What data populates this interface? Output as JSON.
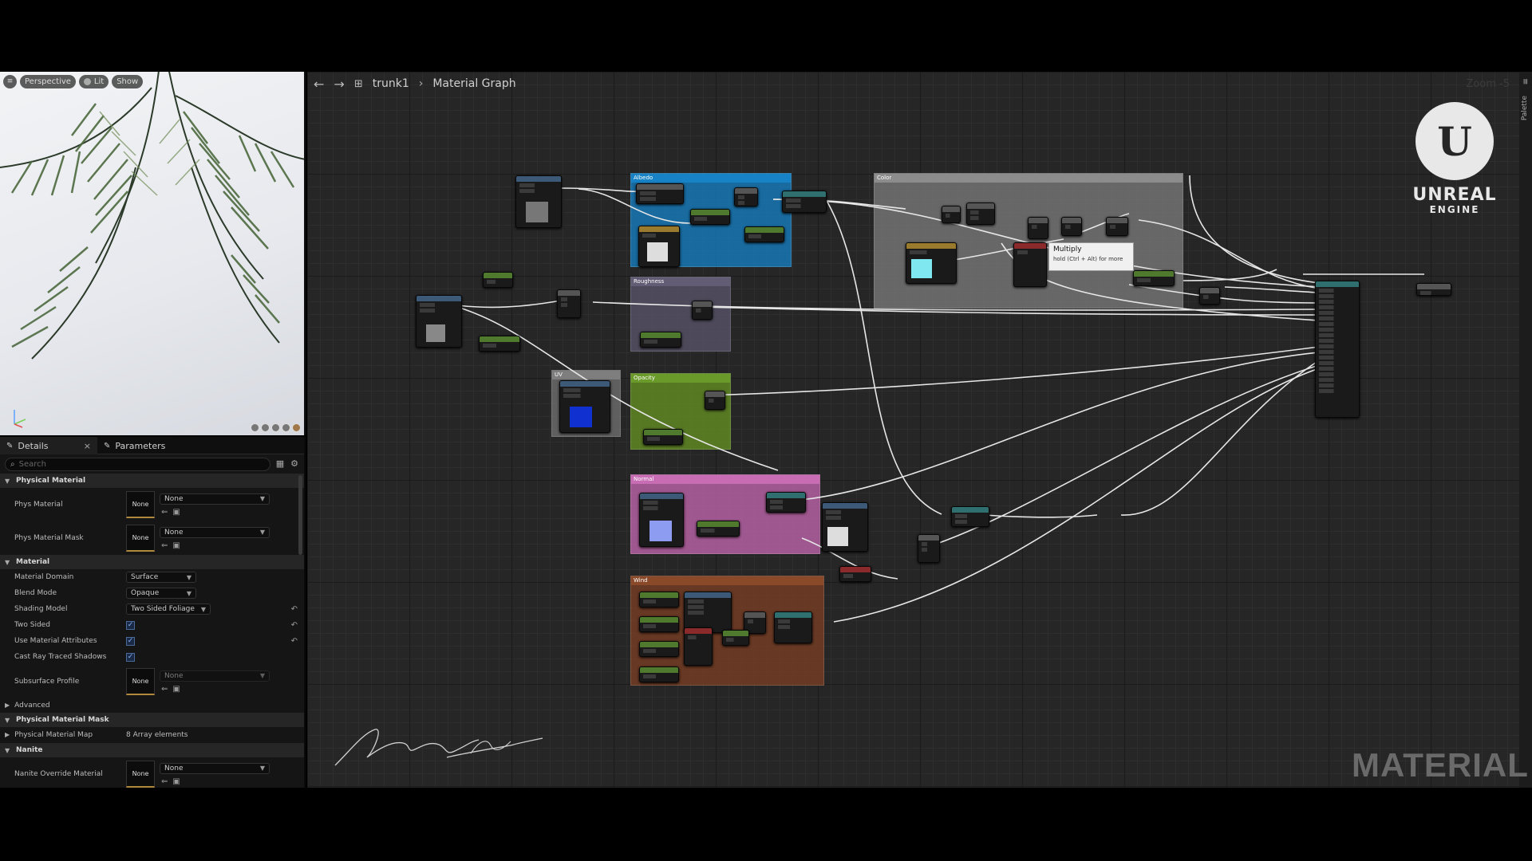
{
  "viewport": {
    "view_mode": "Perspective",
    "lit": "Lit",
    "show": "Show"
  },
  "details": {
    "tabs": [
      {
        "label": "Details"
      },
      {
        "label": "Parameters"
      }
    ],
    "search_placeholder": "Search",
    "sections": {
      "physical_material": "Physical Material",
      "material": "Material",
      "advanced": "Advanced",
      "physical_material_mask": "Physical Material Mask",
      "nanite": "Nanite"
    },
    "props": {
      "phys_material": {
        "label": "Phys Material",
        "thumb": "None",
        "value": "None"
      },
      "phys_material_mask": {
        "label": "Phys Material Mask",
        "thumb": "None",
        "value": "None"
      },
      "material_domain": {
        "label": "Material Domain",
        "value": "Surface"
      },
      "blend_mode": {
        "label": "Blend Mode",
        "value": "Opaque"
      },
      "shading_model": {
        "label": "Shading Model",
        "value": "Two Sided Foliage"
      },
      "two_sided": {
        "label": "Two Sided",
        "checked": true
      },
      "use_material_attributes": {
        "label": "Use Material Attributes",
        "checked": true
      },
      "cast_ray_traced_shadows": {
        "label": "Cast Ray Traced Shadows",
        "checked": true
      },
      "subsurface_profile": {
        "label": "Subsurface Profile",
        "thumb": "None",
        "value": "None"
      },
      "physical_material_map": {
        "label": "Physical Material Map",
        "value": "8 Array elements"
      },
      "nanite_override_material": {
        "label": "Nanite Override Material",
        "thumb": "None",
        "value": "None"
      }
    }
  },
  "graph": {
    "breadcrumb": [
      "trunk1",
      "Material Graph"
    ],
    "zoom": "Zoom -5",
    "palette_label": "Palette",
    "comments": {
      "albedo": "Albedo",
      "color": "Color",
      "roughness": "Roughness",
      "uv": "UV",
      "opacity": "Opacity",
      "normal": "Normal",
      "wind": "Wind"
    },
    "tooltip": {
      "title": "Multiply",
      "hint": "hold (Ctrl + Alt) for more"
    }
  },
  "branding": {
    "logo_text": "UNREAL",
    "logo_sub": "ENGINE",
    "watermark": "MATERIAL",
    "accent": "#2b8fd6"
  }
}
